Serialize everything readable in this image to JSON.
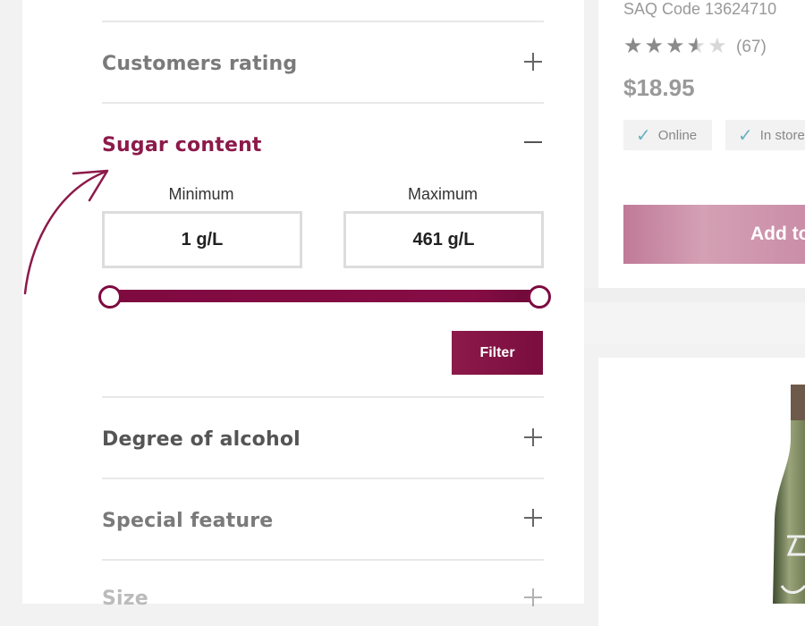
{
  "filters": {
    "sections": [
      {
        "label": "Customers rating"
      },
      {
        "label": "Sugar content"
      },
      {
        "label": "Degree of alcohol"
      },
      {
        "label": "Special feature"
      },
      {
        "label": "Size"
      }
    ],
    "sugar": {
      "min_label": "Minimum",
      "max_label": "Maximum",
      "min_value": "1 g/L",
      "max_value": "461 g/L",
      "slider_min_fraction": 0.0,
      "slider_max_fraction": 1.0,
      "filter_button": "Filter"
    }
  },
  "product": {
    "saq_code": "SAQ Code 13624710",
    "rating": 3.5,
    "review_count": "(67)",
    "price": "$18.95",
    "availability": [
      {
        "label": "Online",
        "icon": "check-icon"
      },
      {
        "label": "In store",
        "icon": "check-icon"
      }
    ],
    "add_button": "Add to cart"
  },
  "colors": {
    "accent": "#8c1a4a",
    "slider": "#7e0a40",
    "check": "#6ab0c0"
  }
}
